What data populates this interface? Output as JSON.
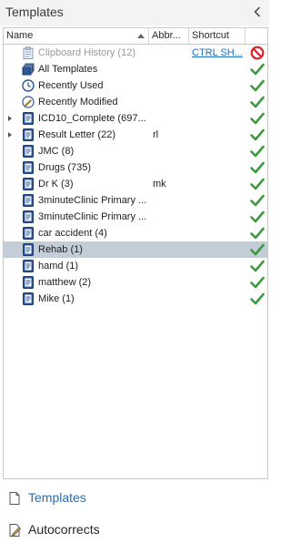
{
  "panel": {
    "title": "Templates"
  },
  "columns": {
    "name": "Name",
    "abbr": "Abbr...",
    "shortcut": "Shortcut"
  },
  "rows": [
    {
      "name": "Clipboard History (12)",
      "abbr": "",
      "shortcut": "CTRL SH...",
      "icon": "clipboard-icon",
      "status": "prohibited",
      "expandable": false,
      "disabled": true,
      "selected": false
    },
    {
      "name": "All Templates",
      "abbr": "",
      "shortcut": "",
      "icon": "stack-icon",
      "status": "check",
      "expandable": false,
      "disabled": false,
      "selected": false
    },
    {
      "name": "Recently Used",
      "abbr": "",
      "shortcut": "",
      "icon": "clock-icon",
      "status": "check",
      "expandable": false,
      "disabled": false,
      "selected": false
    },
    {
      "name": "Recently Modified",
      "abbr": "",
      "shortcut": "",
      "icon": "recent-modified-icon",
      "status": "check",
      "expandable": false,
      "disabled": false,
      "selected": false
    },
    {
      "name": "ICD10_Complete (697...",
      "abbr": "",
      "shortcut": "",
      "icon": "template-book-icon",
      "status": "check",
      "expandable": true,
      "disabled": false,
      "selected": false
    },
    {
      "name": "Result Letter (22)",
      "abbr": "rl",
      "shortcut": "",
      "icon": "template-book-icon",
      "status": "check",
      "expandable": true,
      "disabled": false,
      "selected": false
    },
    {
      "name": "JMC (8)",
      "abbr": "",
      "shortcut": "",
      "icon": "template-book-icon",
      "status": "check",
      "expandable": false,
      "disabled": false,
      "selected": false
    },
    {
      "name": "Drugs (735)",
      "abbr": "",
      "shortcut": "",
      "icon": "template-book-icon",
      "status": "check",
      "expandable": false,
      "disabled": false,
      "selected": false
    },
    {
      "name": "Dr K (3)",
      "abbr": "mk",
      "shortcut": "",
      "icon": "template-book-icon",
      "status": "check",
      "expandable": false,
      "disabled": false,
      "selected": false
    },
    {
      "name": "3minuteClinic Primary ...",
      "abbr": "",
      "shortcut": "",
      "icon": "template-book-icon",
      "status": "check",
      "expandable": false,
      "disabled": false,
      "selected": false
    },
    {
      "name": "3minuteClinic Primary ...",
      "abbr": "",
      "shortcut": "",
      "icon": "template-book-icon",
      "status": "check",
      "expandable": false,
      "disabled": false,
      "selected": false
    },
    {
      "name": "car accident (4)",
      "abbr": "",
      "shortcut": "",
      "icon": "template-book-icon",
      "status": "check",
      "expandable": false,
      "disabled": false,
      "selected": false
    },
    {
      "name": "Rehab (1)",
      "abbr": "",
      "shortcut": "",
      "icon": "template-book-icon",
      "status": "check",
      "expandable": false,
      "disabled": false,
      "selected": true
    },
    {
      "name": "hamd (1)",
      "abbr": "",
      "shortcut": "",
      "icon": "template-book-icon",
      "status": "check",
      "expandable": false,
      "disabled": false,
      "selected": false
    },
    {
      "name": "matthew (2)",
      "abbr": "",
      "shortcut": "",
      "icon": "template-book-icon",
      "status": "check",
      "expandable": false,
      "disabled": false,
      "selected": false
    },
    {
      "name": "Mike (1)",
      "abbr": "",
      "shortcut": "",
      "icon": "template-book-icon",
      "status": "check",
      "expandable": false,
      "disabled": false,
      "selected": false
    }
  ],
  "nav": [
    {
      "label": "Templates",
      "icon": "document-icon",
      "active": true
    },
    {
      "label": "Autocorrects",
      "icon": "autocorrect-icon",
      "active": false
    }
  ],
  "colors": {
    "accent": "#2a6db4",
    "check": "#3c9b3c",
    "prohibited": "#d9232a",
    "selected_row": "#c3cdd8",
    "book_icon": "#2b579a"
  }
}
